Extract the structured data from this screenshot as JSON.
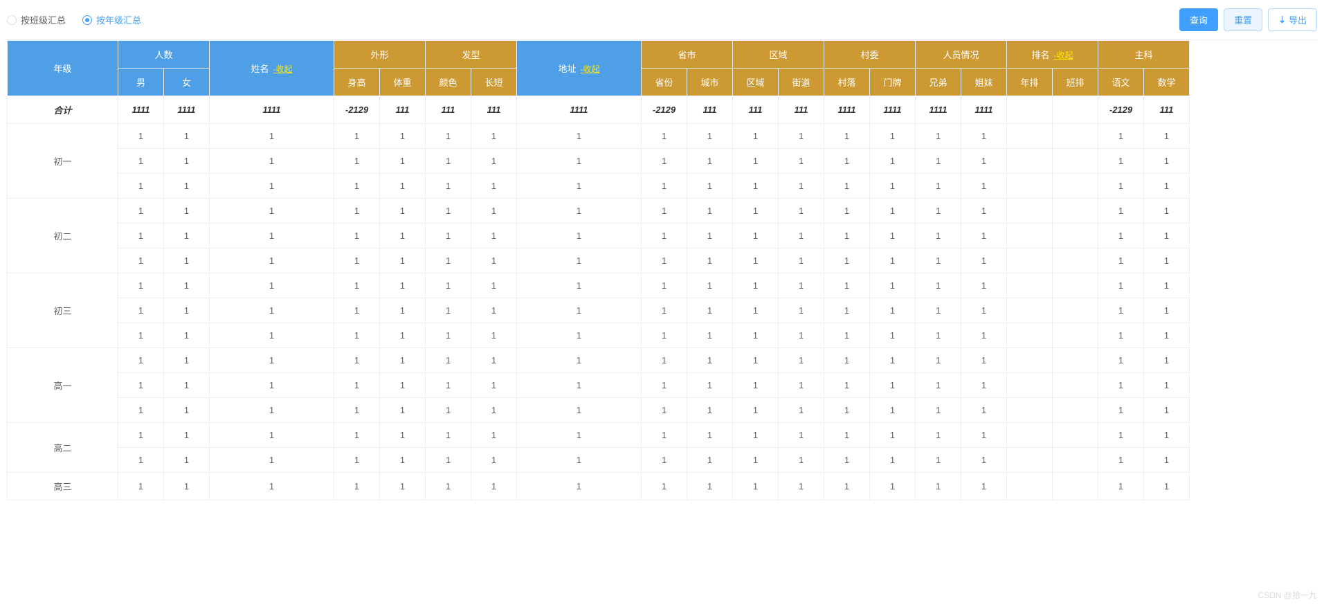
{
  "radios": {
    "byClass": "按班级汇总",
    "byGrade": "按年级汇总"
  },
  "buttons": {
    "query": "查询",
    "reset": "重置",
    "export": "导出"
  },
  "collapse": "-收起",
  "group_headers": {
    "grade": "年级",
    "count": "人数",
    "name": "姓名",
    "shape": "外形",
    "hair": "发型",
    "address": "地址",
    "prov_city": "省市",
    "region": "区域",
    "village": "村委",
    "people": "人员情况",
    "rank": "排名",
    "major": "主科"
  },
  "sub_headers": {
    "male": "男",
    "female": "女",
    "height": "身高",
    "weight": "体重",
    "color": "颜色",
    "length": "长短",
    "province": "省份",
    "city": "城市",
    "area": "区域",
    "street": "街道",
    "village2": "村落",
    "doorplate": "门牌",
    "brothers": "兄弟",
    "sisters": "姐妹",
    "yearRank": "年排",
    "classRank": "班排",
    "chinese": "语文",
    "math": "数学"
  },
  "total_label": "合计",
  "total_row": {
    "male": "1111",
    "female": "1111",
    "name": "1111",
    "height": "-2129",
    "weight": "111",
    "color": "111",
    "length": "111",
    "address": "1111",
    "province": "-2129",
    "city": "111",
    "area": "111",
    "street": "111",
    "village2": "1111",
    "doorplate": "1111",
    "brothers": "1111",
    "sisters": "1111",
    "yearRank": "",
    "classRank": "",
    "chinese": "-2129",
    "math": "111"
  },
  "grades": [
    {
      "name": "初一",
      "rows": 3
    },
    {
      "name": "初二",
      "rows": 3
    },
    {
      "name": "初三",
      "rows": 3
    },
    {
      "name": "高一",
      "rows": 3
    },
    {
      "name": "高二",
      "rows": 2
    },
    {
      "name": "高三",
      "rows": 1
    }
  ],
  "cell_value": "1",
  "watermark": "CSDN @拾一九"
}
